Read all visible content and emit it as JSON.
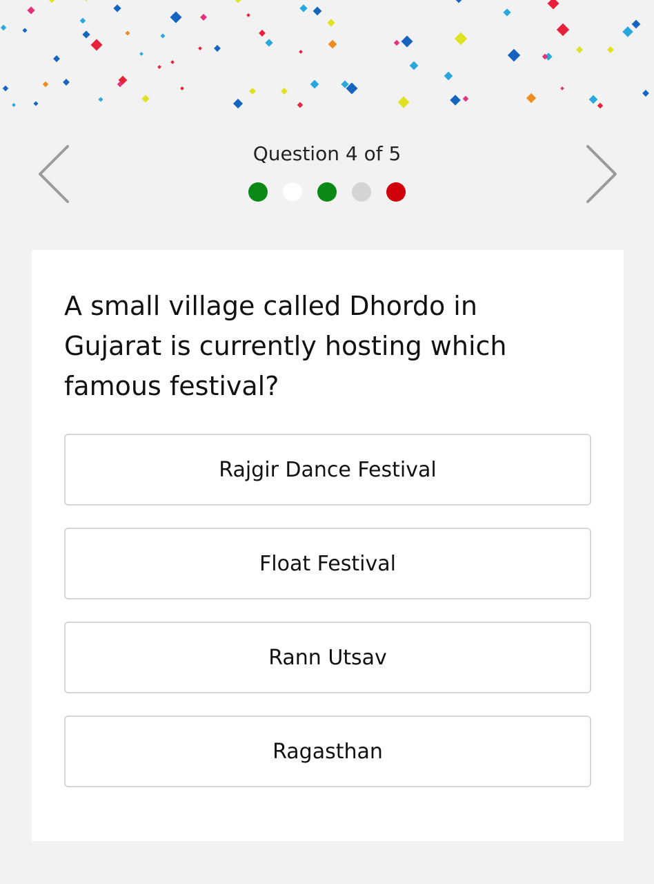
{
  "quiz": {
    "counter": "Question 4 of 5",
    "progress": [
      {
        "status": "correct",
        "color": "#0a8a14"
      },
      {
        "status": "current",
        "color": "#ffffff"
      },
      {
        "status": "correct",
        "color": "#0a8a14"
      },
      {
        "status": "unanswered",
        "color": "#d4d4d4"
      },
      {
        "status": "wrong",
        "color": "#d0000a"
      }
    ],
    "question": "A small village called Dhordo in Gujarat is currently hosting which famous festival?",
    "answers": [
      {
        "label": "Rajgir Dance Festival"
      },
      {
        "label": "Float Festival"
      },
      {
        "label": "Rann Utsav"
      },
      {
        "label": "Ragasthan"
      }
    ]
  },
  "navigation": {
    "prev_icon": "chevron-left-icon",
    "next_icon": "chevron-right-icon"
  },
  "decoration": {
    "confetti_colors": [
      "#1565c0",
      "#29a8e0",
      "#e8203a",
      "#e8307a",
      "#f08c1e",
      "#dfe223"
    ]
  }
}
